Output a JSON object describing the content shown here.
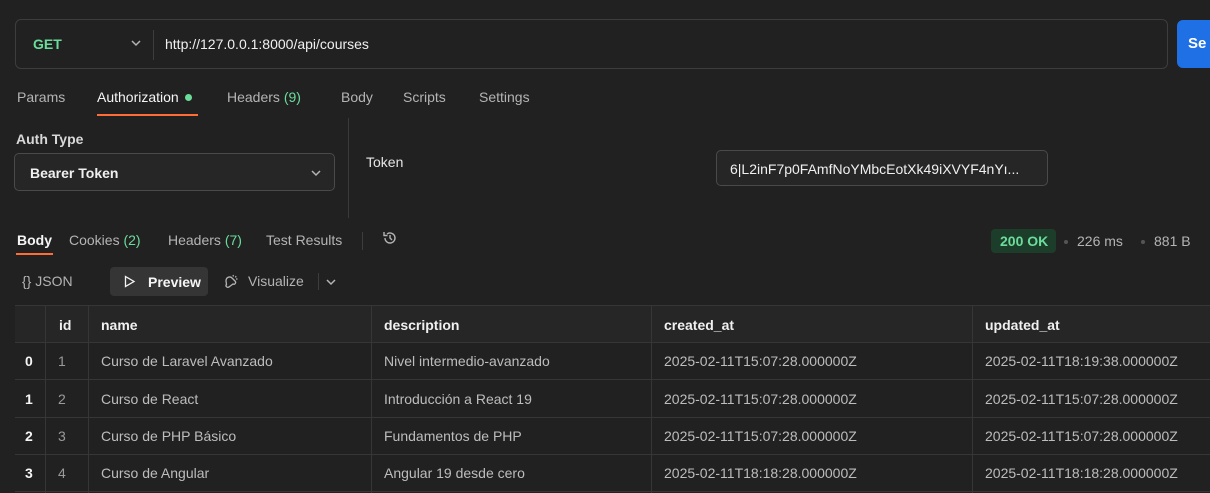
{
  "request": {
    "method": "GET",
    "url": "http://127.0.0.1:8000/api/courses",
    "send_label": "Se"
  },
  "request_tabs": [
    {
      "label": "Params"
    },
    {
      "label": "Authorization"
    },
    {
      "label": "Headers",
      "count": "(9)"
    },
    {
      "label": "Body"
    },
    {
      "label": "Scripts"
    },
    {
      "label": "Settings"
    }
  ],
  "auth": {
    "type_label": "Auth Type",
    "type_value": "Bearer Token",
    "token_label": "Token",
    "token_value": "6|L2inF7p0FAmfNoYMbcEotXk49iXVYF4nYı..."
  },
  "response_tabs": [
    {
      "label": "Body"
    },
    {
      "label": "Cookies",
      "count": "(2)"
    },
    {
      "label": "Headers",
      "count": "(7)"
    },
    {
      "label": "Test Results"
    }
  ],
  "response_meta": {
    "status": "200 OK",
    "time": "226 ms",
    "size": "881 B"
  },
  "format_toolbar": {
    "json_label": "JSON",
    "json_icon": "{}",
    "preview_label": "Preview",
    "visualize_label": "Visualize"
  },
  "table": {
    "columns": [
      "id",
      "name",
      "description",
      "created_at",
      "updated_at"
    ],
    "rows": [
      {
        "index": "0",
        "id": "1",
        "name": "Curso de Laravel Avanzado",
        "description": "Nivel intermedio-avanzado",
        "created_at": "2025-02-11T15:07:28.000000Z",
        "updated_at": "2025-02-11T18:19:38.000000Z"
      },
      {
        "index": "1",
        "id": "2",
        "name": "Curso de React",
        "description": "Introducción a React 19",
        "created_at": "2025-02-11T15:07:28.000000Z",
        "updated_at": "2025-02-11T15:07:28.000000Z"
      },
      {
        "index": "2",
        "id": "3",
        "name": "Curso de PHP Básico",
        "description": "Fundamentos de PHP",
        "created_at": "2025-02-11T15:07:28.000000Z",
        "updated_at": "2025-02-11T15:07:28.000000Z"
      },
      {
        "index": "3",
        "id": "4",
        "name": "Curso de Angular",
        "description": "Angular 19 desde cero",
        "created_at": "2025-02-11T18:18:28.000000Z",
        "updated_at": "2025-02-11T18:18:28.000000Z"
      }
    ]
  },
  "colors": {
    "accent_tab": "#ff6c37",
    "method_green": "#6bdd9a",
    "send_blue": "#1f6fe5"
  }
}
